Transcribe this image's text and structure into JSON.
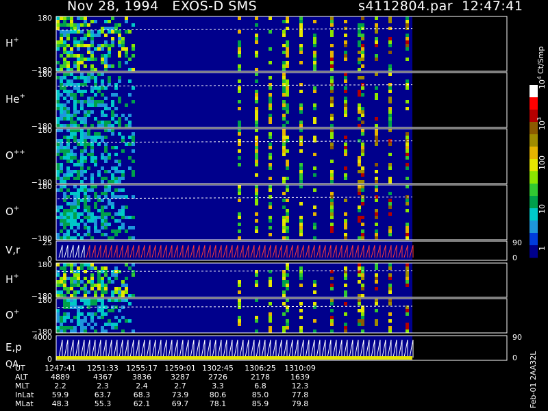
{
  "header": {
    "title": "Nov 28, 1994   EXOS-D SMS",
    "file_info": "s4112804.par  12:47:41"
  },
  "colorbar": {
    "label": "Ct/Smp",
    "ticks": [
      "1",
      "10",
      "100",
      "10",
      "10"
    ],
    "tick_exp": [
      "",
      "",
      "",
      "3",
      "4"
    ],
    "colors": [
      "#00008c",
      "#003cdc",
      "#1e96dc",
      "#00c8c8",
      "#00a04b",
      "#32c832",
      "#8ce600",
      "#e6e600",
      "#e6b400",
      "#a08c00",
      "#8c5a00",
      "#b40000",
      "#ff0000",
      "#ffffff"
    ]
  },
  "colors": {
    "background": "#000000",
    "panel_fill": "#00008c",
    "frame": "#ffffff",
    "trace_dash": "#ffffff",
    "vr_trace": "#ff3c3c",
    "qa_bar": "#e6e600"
  },
  "panels": [
    {
      "ion": "H",
      "sup": "+",
      "ymax": "180",
      "ymin": "−180",
      "right_top": "",
      "right_bot": "",
      "kind": "spec"
    },
    {
      "ion": "He",
      "sup": "+",
      "ymax": "180",
      "ymin": "−180",
      "right_top": "",
      "right_bot": "",
      "kind": "spec"
    },
    {
      "ion": "O",
      "sup": "++",
      "ymax": "180",
      "ymin": "−180",
      "right_top": "",
      "right_bot": "",
      "kind": "spec"
    },
    {
      "ion": "O",
      "sup": "+",
      "ymax": "180",
      "ymin": "−180",
      "right_top": "",
      "right_bot": "",
      "kind": "spec"
    },
    {
      "ion": "V,r",
      "sup": "",
      "ymax": "25",
      "ymin": "0",
      "right_top": "90",
      "right_bot": "0",
      "kind": "trace"
    },
    {
      "ion": "H",
      "sup": "+",
      "ymax": "180",
      "ymin": "−180",
      "right_top": "",
      "right_bot": "",
      "kind": "spec"
    },
    {
      "ion": "O",
      "sup": "+",
      "ymax": "180",
      "ymin": "−180",
      "right_top": "",
      "right_bot": "",
      "kind": "spec"
    },
    {
      "ion": "E,p",
      "sup": "",
      "ymax": "4000",
      "ymin": "0",
      "right_top": "90",
      "right_bot": "0",
      "kind": "trace",
      "extra": "QA"
    }
  ],
  "bottom_rows": [
    {
      "name": "UT",
      "values": [
        "1247:41",
        "1251:33",
        "1255:17",
        "1259:01",
        "1302:45",
        "1306:25",
        "1310:09"
      ]
    },
    {
      "name": "ALT",
      "values": [
        "4889",
        "4367",
        "3836",
        "3287",
        "2726",
        "2178",
        "1639"
      ]
    },
    {
      "name": "MLT",
      "values": [
        "2.2",
        "2.3",
        "2.4",
        "2.7",
        "3.3",
        "6.8",
        "12.3"
      ]
    },
    {
      "name": "InLat",
      "values": [
        "59.9",
        "63.7",
        "68.3",
        "73.9",
        "80.6",
        "85.0",
        "77.8"
      ]
    },
    {
      "name": "MLat",
      "values": [
        "48.3",
        "55.3",
        "62.1",
        "69.7",
        "78.1",
        "85.9",
        "79.8"
      ]
    }
  ],
  "side_code": "Feb-01 2AA32L",
  "chart_data": {
    "type": "heatmap",
    "x": [
      "1247:41",
      "1251:33",
      "1255:17",
      "1259:01",
      "1302:45",
      "1306:25",
      "1310:09"
    ],
    "panels": [
      "H+",
      "He+",
      "O++",
      "O+",
      "V,r",
      "H+",
      "O+",
      "E,p / QA"
    ],
    "ylim_pitch_angle": [
      -180,
      180
    ],
    "colorbar_range": [
      1,
      10000
    ],
    "colorbar_scale": "log"
  }
}
